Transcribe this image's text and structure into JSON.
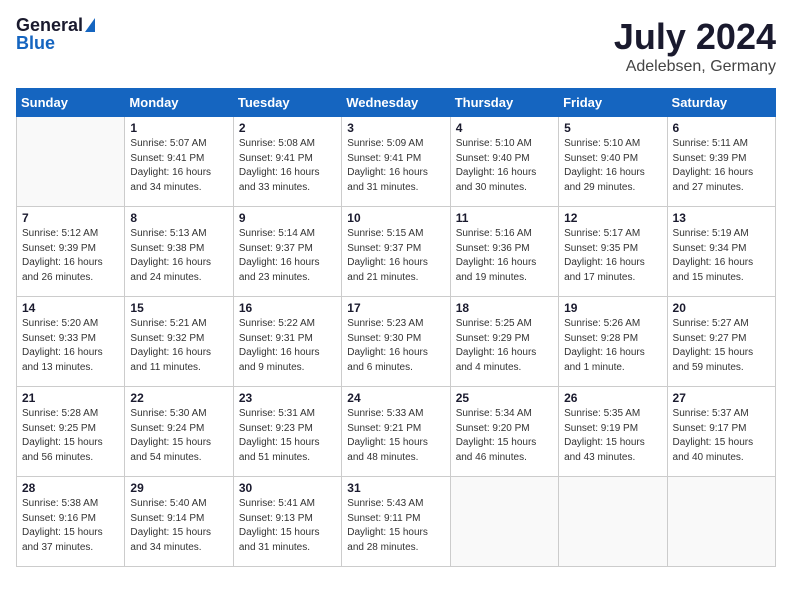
{
  "header": {
    "logo_general": "General",
    "logo_blue": "Blue",
    "month_year": "July 2024",
    "location": "Adelebsen, Germany"
  },
  "columns": [
    "Sunday",
    "Monday",
    "Tuesday",
    "Wednesday",
    "Thursday",
    "Friday",
    "Saturday"
  ],
  "weeks": [
    [
      {
        "day": "",
        "info": ""
      },
      {
        "day": "1",
        "info": "Sunrise: 5:07 AM\nSunset: 9:41 PM\nDaylight: 16 hours\nand 34 minutes."
      },
      {
        "day": "2",
        "info": "Sunrise: 5:08 AM\nSunset: 9:41 PM\nDaylight: 16 hours\nand 33 minutes."
      },
      {
        "day": "3",
        "info": "Sunrise: 5:09 AM\nSunset: 9:41 PM\nDaylight: 16 hours\nand 31 minutes."
      },
      {
        "day": "4",
        "info": "Sunrise: 5:10 AM\nSunset: 9:40 PM\nDaylight: 16 hours\nand 30 minutes."
      },
      {
        "day": "5",
        "info": "Sunrise: 5:10 AM\nSunset: 9:40 PM\nDaylight: 16 hours\nand 29 minutes."
      },
      {
        "day": "6",
        "info": "Sunrise: 5:11 AM\nSunset: 9:39 PM\nDaylight: 16 hours\nand 27 minutes."
      }
    ],
    [
      {
        "day": "7",
        "info": "Sunrise: 5:12 AM\nSunset: 9:39 PM\nDaylight: 16 hours\nand 26 minutes."
      },
      {
        "day": "8",
        "info": "Sunrise: 5:13 AM\nSunset: 9:38 PM\nDaylight: 16 hours\nand 24 minutes."
      },
      {
        "day": "9",
        "info": "Sunrise: 5:14 AM\nSunset: 9:37 PM\nDaylight: 16 hours\nand 23 minutes."
      },
      {
        "day": "10",
        "info": "Sunrise: 5:15 AM\nSunset: 9:37 PM\nDaylight: 16 hours\nand 21 minutes."
      },
      {
        "day": "11",
        "info": "Sunrise: 5:16 AM\nSunset: 9:36 PM\nDaylight: 16 hours\nand 19 minutes."
      },
      {
        "day": "12",
        "info": "Sunrise: 5:17 AM\nSunset: 9:35 PM\nDaylight: 16 hours\nand 17 minutes."
      },
      {
        "day": "13",
        "info": "Sunrise: 5:19 AM\nSunset: 9:34 PM\nDaylight: 16 hours\nand 15 minutes."
      }
    ],
    [
      {
        "day": "14",
        "info": "Sunrise: 5:20 AM\nSunset: 9:33 PM\nDaylight: 16 hours\nand 13 minutes."
      },
      {
        "day": "15",
        "info": "Sunrise: 5:21 AM\nSunset: 9:32 PM\nDaylight: 16 hours\nand 11 minutes."
      },
      {
        "day": "16",
        "info": "Sunrise: 5:22 AM\nSunset: 9:31 PM\nDaylight: 16 hours\nand 9 minutes."
      },
      {
        "day": "17",
        "info": "Sunrise: 5:23 AM\nSunset: 9:30 PM\nDaylight: 16 hours\nand 6 minutes."
      },
      {
        "day": "18",
        "info": "Sunrise: 5:25 AM\nSunset: 9:29 PM\nDaylight: 16 hours\nand 4 minutes."
      },
      {
        "day": "19",
        "info": "Sunrise: 5:26 AM\nSunset: 9:28 PM\nDaylight: 16 hours\nand 1 minute."
      },
      {
        "day": "20",
        "info": "Sunrise: 5:27 AM\nSunset: 9:27 PM\nDaylight: 15 hours\nand 59 minutes."
      }
    ],
    [
      {
        "day": "21",
        "info": "Sunrise: 5:28 AM\nSunset: 9:25 PM\nDaylight: 15 hours\nand 56 minutes."
      },
      {
        "day": "22",
        "info": "Sunrise: 5:30 AM\nSunset: 9:24 PM\nDaylight: 15 hours\nand 54 minutes."
      },
      {
        "day": "23",
        "info": "Sunrise: 5:31 AM\nSunset: 9:23 PM\nDaylight: 15 hours\nand 51 minutes."
      },
      {
        "day": "24",
        "info": "Sunrise: 5:33 AM\nSunset: 9:21 PM\nDaylight: 15 hours\nand 48 minutes."
      },
      {
        "day": "25",
        "info": "Sunrise: 5:34 AM\nSunset: 9:20 PM\nDaylight: 15 hours\nand 46 minutes."
      },
      {
        "day": "26",
        "info": "Sunrise: 5:35 AM\nSunset: 9:19 PM\nDaylight: 15 hours\nand 43 minutes."
      },
      {
        "day": "27",
        "info": "Sunrise: 5:37 AM\nSunset: 9:17 PM\nDaylight: 15 hours\nand 40 minutes."
      }
    ],
    [
      {
        "day": "28",
        "info": "Sunrise: 5:38 AM\nSunset: 9:16 PM\nDaylight: 15 hours\nand 37 minutes."
      },
      {
        "day": "29",
        "info": "Sunrise: 5:40 AM\nSunset: 9:14 PM\nDaylight: 15 hours\nand 34 minutes."
      },
      {
        "day": "30",
        "info": "Sunrise: 5:41 AM\nSunset: 9:13 PM\nDaylight: 15 hours\nand 31 minutes."
      },
      {
        "day": "31",
        "info": "Sunrise: 5:43 AM\nSunset: 9:11 PM\nDaylight: 15 hours\nand 28 minutes."
      },
      {
        "day": "",
        "info": ""
      },
      {
        "day": "",
        "info": ""
      },
      {
        "day": "",
        "info": ""
      }
    ]
  ]
}
